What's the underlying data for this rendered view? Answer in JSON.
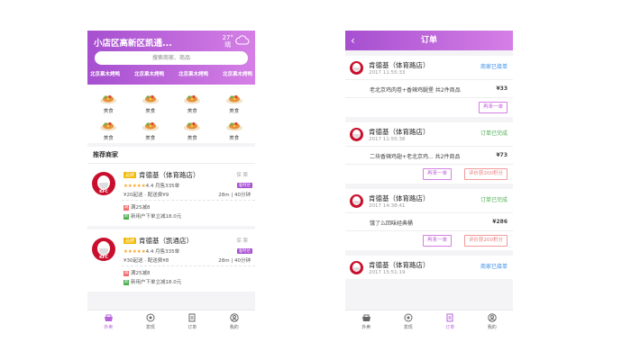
{
  "colors": {
    "accent": "#b663db",
    "status_green": "#4caf50",
    "status_blue": "#3a8ee6",
    "brand_yellow": "#f5b800",
    "kfc_red": "#c8102e"
  },
  "home": {
    "location": "小店区高新区凯通...",
    "weather": {
      "temp": "27°",
      "desc": "晴",
      "icon": "cloud-icon"
    },
    "search_placeholder": "搜索商家、商品",
    "quick_tags": [
      "北京果木烤鸭",
      "北京果木烤鸭",
      "北京果木烤鸭",
      "北京果木烤鸭"
    ],
    "categories": [
      "美食",
      "美食",
      "美食",
      "美食",
      "美食",
      "美食",
      "美食",
      "美食"
    ],
    "recommend_title": "推荐商家",
    "shops": [
      {
        "brand": "品牌",
        "name": "肯德基（体育路店）",
        "insure": "保 票",
        "rating": "4.4",
        "monthly": "月售335单",
        "ontime": "准时达",
        "fee": "¥20起送 · 配送费¥9",
        "dist": "28m",
        "time": "40分钟",
        "promos": [
          {
            "badge": "减",
            "text": "满25减8",
            "color": "#f06c6c"
          },
          {
            "badge": "新",
            "text": "新用户下单立减18.0元",
            "color": "#4caf50"
          }
        ]
      },
      {
        "brand": "品牌",
        "name": "肯德基（凯通店）",
        "insure": "保 票",
        "rating": "4.4",
        "monthly": "月售335单",
        "ontime": "准时达",
        "fee": "¥30起送 · 配送费¥8",
        "dist": "28m",
        "time": "40分钟",
        "promos": [
          {
            "badge": "减",
            "text": "满25减8",
            "color": "#f06c6c"
          },
          {
            "badge": "新",
            "text": "新用户下单立减18.0元",
            "color": "#4caf50"
          }
        ]
      }
    ]
  },
  "orders": {
    "title": "订单",
    "list": [
      {
        "shop": "肯德基（体育路店）",
        "time": "2017 11:55:33",
        "status": "商家已接单",
        "status_color": "#3a8ee6",
        "items": "老北京鸡肉卷+香辣鸡腿堡 共2件商品",
        "price": "¥33",
        "buttons": [
          "再来一单"
        ]
      },
      {
        "shop": "肯德基（体育路店）",
        "time": "2017 11:55:38",
        "status": "订单已完成",
        "status_color": "#4caf50",
        "items": "二块香辣鸡翅+老北京鸡... 共2件商品",
        "price": "¥73",
        "buttons": [
          "再来一单",
          "评价获200积分"
        ]
      },
      {
        "shop": "肯德基（体育路店）",
        "time": "2017 14:38:41",
        "status": "订单已完成",
        "status_color": "#4caf50",
        "items": "饿了么回味经典桶",
        "price": "¥286",
        "buttons": [
          "再来一单",
          "评价获200积分"
        ]
      },
      {
        "shop": "肯德基（体育路店）",
        "time": "2017 15:51:19",
        "status": "商家已接单",
        "status_color": "#3a8ee6"
      }
    ]
  },
  "tabbar": [
    "外卖",
    "发现",
    "订单",
    "我的"
  ]
}
